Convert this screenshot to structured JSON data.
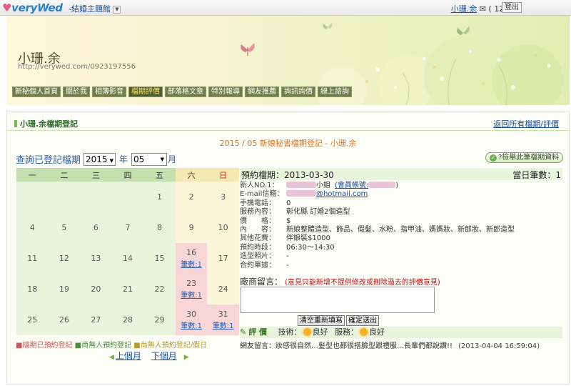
{
  "header": {
    "logo": "veryWed",
    "hall": "-結婚主題館",
    "user": "小珊.余",
    "points": "( 1278 )",
    "logout": "登出"
  },
  "banner": {
    "name": "小珊.余",
    "url": "http://verywed.com/0923197556",
    "menu": [
      "新秘個人首頁",
      "關於我",
      "相簿影音",
      "檔期評價",
      "部落格文章",
      "特別報導",
      "網友推薦",
      "詢訊詢價",
      "線上諮詢"
    ],
    "active": "檔期評價"
  },
  "panel": {
    "title": "小珊.余檔期登記",
    "back_link": "返回所有檔期/評價",
    "subtitle": "2015 / 05 新娘秘書檔期登記 - 小珊.余",
    "query_label": "查詢已登記檔期",
    "year": "2015",
    "year_unit": "年",
    "month": "05",
    "month_unit": "月",
    "check_button": "?檢舉此筆檔期資料"
  },
  "calendar": {
    "weekdays": [
      "一",
      "二",
      "三",
      "四",
      "五",
      "六",
      "日"
    ],
    "weeks": [
      [
        {
          "d": ""
        },
        {
          "d": ""
        },
        {
          "d": ""
        },
        {
          "d": ""
        },
        {
          "d": "1"
        },
        {
          "d": "2",
          "w": 1
        },
        {
          "d": "3",
          "w": 1
        }
      ],
      [
        {
          "d": "4"
        },
        {
          "d": "5"
        },
        {
          "d": "6"
        },
        {
          "d": "7"
        },
        {
          "d": "8"
        },
        {
          "d": "9",
          "w": 1
        },
        {
          "d": "10",
          "w": 1
        }
      ],
      [
        {
          "d": "11"
        },
        {
          "d": "12"
        },
        {
          "d": "13"
        },
        {
          "d": "14"
        },
        {
          "d": "15"
        },
        {
          "d": "16",
          "b": 1,
          "c": "筆數:1"
        },
        {
          "d": "17",
          "w": 1
        }
      ],
      [
        {
          "d": "18"
        },
        {
          "d": "19"
        },
        {
          "d": "20"
        },
        {
          "d": "21"
        },
        {
          "d": "22"
        },
        {
          "d": "23",
          "b": 1,
          "c": "筆數:1"
        },
        {
          "d": "24",
          "w": 1
        }
      ],
      [
        {
          "d": "25"
        },
        {
          "d": "26"
        },
        {
          "d": "27"
        },
        {
          "d": "28"
        },
        {
          "d": "29"
        },
        {
          "d": "30",
          "b": 1,
          "c": "筆數:1"
        },
        {
          "d": "31",
          "b": 1,
          "c": "筆數:1"
        }
      ]
    ]
  },
  "legend": {
    "booked": "■檔期已預約登記",
    "free": "■尚無人預約登記",
    "free_holiday": "■尚無人預約登記/假日"
  },
  "pager": {
    "prev": "上個月",
    "next": "下個月"
  },
  "detail": {
    "date_label": "預約檔期：",
    "date": "2013-03-30",
    "count_label": "當日筆數：",
    "count": "1",
    "rows": [
      {
        "k": "新人NO.1：",
        "v": "小姐",
        "extra": "(會員帳號:",
        "extra2": ")"
      },
      {
        "k": "E-mail信箱：",
        "v": "@hotmail.com"
      },
      {
        "k": "手機電話：",
        "v": "0"
      },
      {
        "k": "服務內容：",
        "v": "彰化縣 訂婚2個造型"
      },
      {
        "k": "價　　格：",
        "v": "$"
      },
      {
        "k": "內　　容：",
        "v": "新娘整體造型、飾品、假髮、水粉、指甲油、媽媽妝、新郎妝、新郎造型"
      },
      {
        "k": "其他花費：",
        "v": "伴娘裝$1000"
      },
      {
        "k": "預約時段：",
        "v": "06:30～14:30"
      },
      {
        "k": "造型照片：",
        "v": "-"
      },
      {
        "k": "合約單據：",
        "v": "-"
      }
    ],
    "vendor_label": "廠商留言：",
    "vendor_note": "(意見只能新增不提供修改或刪除過去的評價意見)",
    "clear_button": "清空重新填寫",
    "submit_button": "確定送出",
    "rating_label": "評 價",
    "tech_label": "技術：",
    "tech_value": "良好",
    "service_label": "服務：",
    "service_value": "良好",
    "comment": "網友留言：妝感很自然…髮型也都很搭臉型跟禮服…長輩們都說讚!!",
    "comment_time": "(2013-04-04 16:59:04)"
  }
}
